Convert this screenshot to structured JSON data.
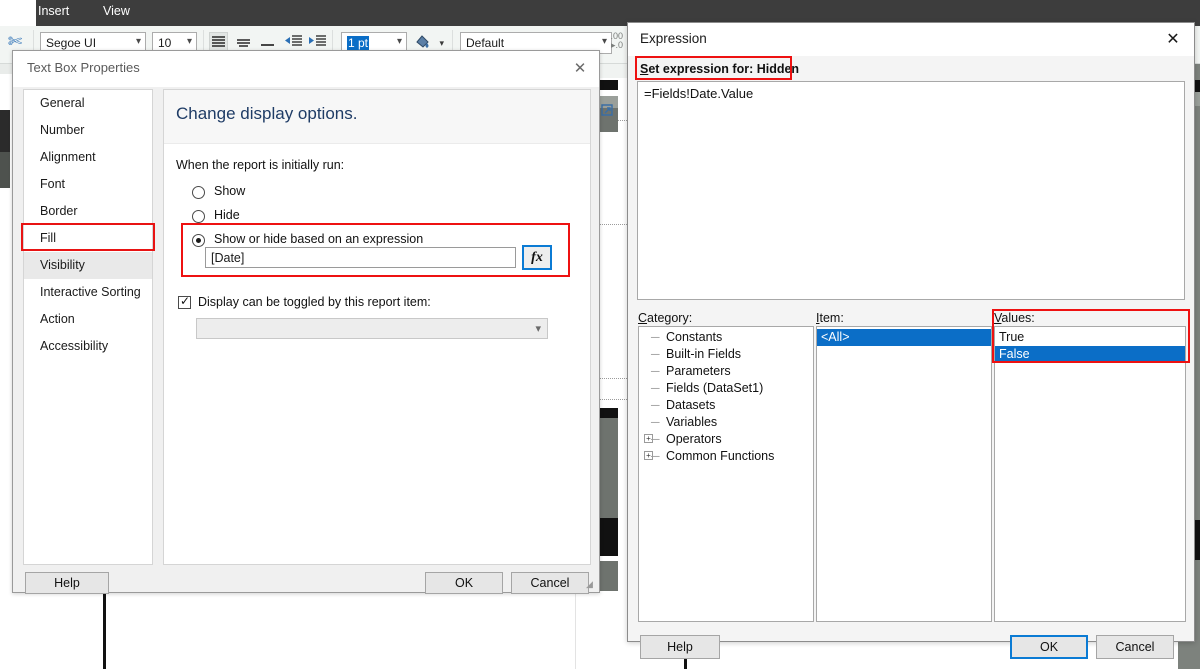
{
  "background_app": {
    "menubar": {
      "items": [
        {
          "label": "Insert"
        },
        {
          "label": "View"
        }
      ]
    },
    "toolbar": {
      "cut_icon": "scissors-icon",
      "font_family": "Segoe UI",
      "font_size": "10",
      "border_width": "1 pt",
      "border_style": "Default",
      "fill_icon": "paint-bucket-icon",
      "decimal_icon": "decrease-decimal-icon",
      "dialog_launcher_icon": "dialog-launcher-icon",
      "align_icons": [
        "align-justify-icon",
        "align-center-icon",
        "align-bottom-icon",
        "decrease-indent-icon",
        "increase-indent-icon"
      ]
    }
  },
  "textbox_dialog": {
    "title": "Text Box Properties",
    "close_icon": "close-icon",
    "nav_items": [
      {
        "label": "General",
        "active": false
      },
      {
        "label": "Number",
        "active": false
      },
      {
        "label": "Alignment",
        "active": false
      },
      {
        "label": "Font",
        "active": false
      },
      {
        "label": "Border",
        "active": false
      },
      {
        "label": "Fill",
        "active": false
      },
      {
        "label": "Visibility",
        "active": true
      },
      {
        "label": "Interactive Sorting",
        "active": false
      },
      {
        "label": "Action",
        "active": false
      },
      {
        "label": "Accessibility",
        "active": false
      }
    ],
    "pane": {
      "heading": "Change display options.",
      "group_label": "When the report is initially run:",
      "radios": [
        {
          "label": "Show",
          "selected": false
        },
        {
          "label": "Hide",
          "selected": false
        },
        {
          "label": "Show or hide based on an expression",
          "selected": true
        }
      ],
      "expression_value": "[Date]",
      "fx_button_label": "fx",
      "toggle_checkbox_label": "Display can be toggled by this report item:",
      "toggle_checkbox_checked": true,
      "toggle_select_value": ""
    },
    "buttons": {
      "help": "Help",
      "ok": "OK",
      "cancel": "Cancel"
    }
  },
  "expression_dialog": {
    "title": "Expression",
    "close_icon": "close-icon",
    "set_expression_prefix": "S",
    "set_expression_label": "et expression for: Hidden",
    "expression_text": "=Fields!Date.Value",
    "category": {
      "label_underline": "C",
      "label": "ategory:",
      "items": [
        {
          "label": "Constants",
          "expandable": false
        },
        {
          "label": "Built-in Fields",
          "expandable": false
        },
        {
          "label": "Parameters",
          "expandable": false
        },
        {
          "label": "Fields (DataSet1)",
          "expandable": false
        },
        {
          "label": "Datasets",
          "expandable": false
        },
        {
          "label": "Variables",
          "expandable": false
        },
        {
          "label": "Operators",
          "expandable": true
        },
        {
          "label": "Common Functions",
          "expandable": true
        }
      ]
    },
    "item": {
      "label_underline": "I",
      "label": "tem:",
      "items": [
        {
          "label": "<All>",
          "selected": true
        }
      ]
    },
    "values": {
      "label_underline": "V",
      "label": "alues:",
      "items": [
        {
          "label": "True",
          "selected": false
        },
        {
          "label": "False",
          "selected": true
        }
      ]
    },
    "buttons": {
      "help": "Help",
      "ok": "OK",
      "cancel": "Cancel"
    }
  },
  "annotation_color": "#ee1111",
  "accent_color": "#0b7bd4",
  "selection_color": "#0b6ec7"
}
